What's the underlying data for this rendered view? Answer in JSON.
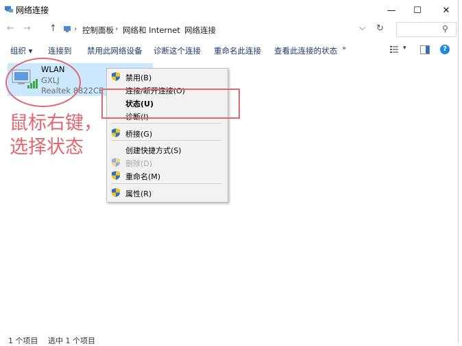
{
  "window": {
    "title": "网络连接",
    "minimize": "—",
    "maximize": "☐",
    "close": "✕"
  },
  "nav": {
    "back": "←",
    "forward": "→",
    "up": "↑",
    "breadcrumb": [
      "控制面板",
      "网络和 Internet",
      "网络连接"
    ],
    "separator": "›",
    "dropdown": "⌵",
    "refresh": "↻",
    "search_icon": "⚲"
  },
  "toolbar": {
    "organize": "组织 ▾",
    "connect_to": "连接到",
    "disable_device": "禁用此网络设备",
    "diagnose": "诊断这个连接",
    "rename": "重命名此连接",
    "view_status": "查看此连接的状态",
    "more": "»",
    "view_caret": "▾",
    "help": "?"
  },
  "connection": {
    "name": "WLAN",
    "ssid": "GXLJ",
    "adapter": "Realtek 8822CE Wi..."
  },
  "context_menu": {
    "items": [
      {
        "label": "禁用(B)",
        "shield": true,
        "disabled": false,
        "bold": false
      },
      {
        "label": "连接/断开连接(O)",
        "shield": false,
        "disabled": false,
        "bold": false
      },
      {
        "label": "状态(U)",
        "shield": false,
        "disabled": false,
        "bold": true
      },
      {
        "label": "诊断(I)",
        "shield": false,
        "disabled": false,
        "bold": false
      },
      {
        "label": "桥接(G)",
        "shield": true,
        "disabled": false,
        "bold": false
      },
      {
        "label": "创建快捷方式(S)",
        "shield": false,
        "disabled": false,
        "bold": false
      },
      {
        "label": "删除(D)",
        "shield": true,
        "disabled": true,
        "bold": false
      },
      {
        "label": "重命名(M)",
        "shield": true,
        "disabled": false,
        "bold": false
      },
      {
        "label": "属性(R)",
        "shield": true,
        "disabled": false,
        "bold": false
      }
    ]
  },
  "annotation": {
    "line1": "鼠标右键，",
    "line2": "选择状态",
    "color": "#e06670"
  },
  "status": {
    "count": "1 个项目",
    "selected": "选中 1 个项目"
  },
  "colors": {
    "selection": "#cce8ff",
    "accent": "#1d8ae0",
    "link_text": "#1e3a6b"
  }
}
